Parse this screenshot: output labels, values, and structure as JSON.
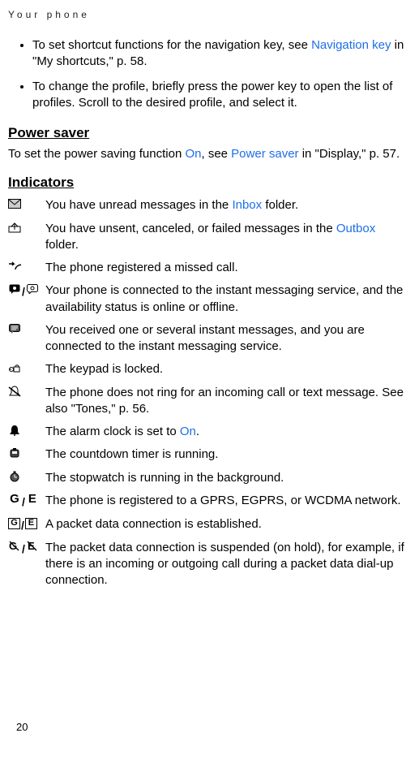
{
  "header": "Your phone",
  "bullets": [
    {
      "pre": "To set shortcut functions for the navigation key, see ",
      "link": "Navigation key",
      "post": " in \"My shortcuts,\" p. 58."
    },
    {
      "pre": "To change the profile, briefly press the power key to open the list of profiles. Scroll to the desired profile, and select it.",
      "link": "",
      "post": ""
    }
  ],
  "powerSaver": {
    "heading": "Power saver",
    "text_pre": "To set the power saving function ",
    "link1": "On",
    "text_mid": ", see ",
    "link2": "Power saver",
    "text_post": " in \"Display,\" p. 57."
  },
  "indicators": {
    "heading": "Indicators",
    "rows": [
      {
        "icon": "envelope",
        "pre": "You have unread messages in the ",
        "link": "Inbox",
        "post": " folder."
      },
      {
        "icon": "outbox",
        "pre": "You have unsent, canceled, or failed messages in the ",
        "link": "Outbox",
        "post": " folder."
      },
      {
        "icon": "missed",
        "pre": "The phone registered a missed call.",
        "link": "",
        "post": ""
      },
      {
        "icon": "im-pair",
        "pre": "Your phone is connected to the instant messaging service, and the availability status is online or offline.",
        "link": "",
        "post": ""
      },
      {
        "icon": "im-msg",
        "pre": "You received one or several instant messages, and you are connected to the instant messaging service.",
        "link": "",
        "post": ""
      },
      {
        "icon": "lock",
        "pre": "The keypad is locked.",
        "link": "",
        "post": ""
      },
      {
        "icon": "silent",
        "pre": "The phone does not ring for an incoming call or text message. See also \"Tones,\" p. 56.",
        "link": "",
        "post": ""
      },
      {
        "icon": "alarm",
        "pre": "The alarm clock is set to ",
        "link": "On",
        "post": "."
      },
      {
        "icon": "timer",
        "pre": "The countdown timer is running.",
        "link": "",
        "post": ""
      },
      {
        "icon": "stopwatch",
        "pre": "The stopwatch is running in the background.",
        "link": "",
        "post": ""
      },
      {
        "icon": "ge-pair",
        "pre": "The phone is registered to a GPRS, EGPRS, or WCDMA network.",
        "link": "",
        "post": ""
      },
      {
        "icon": "ge-box-pair",
        "pre": "A packet data connection is established.",
        "link": "",
        "post": ""
      },
      {
        "icon": "ge-susp-pair",
        "pre": "The packet data connection is suspended (on hold), for example, if there is an incoming or outgoing call during a packet data dial-up connection.",
        "link": "",
        "post": ""
      }
    ]
  },
  "pageNumber": "20"
}
